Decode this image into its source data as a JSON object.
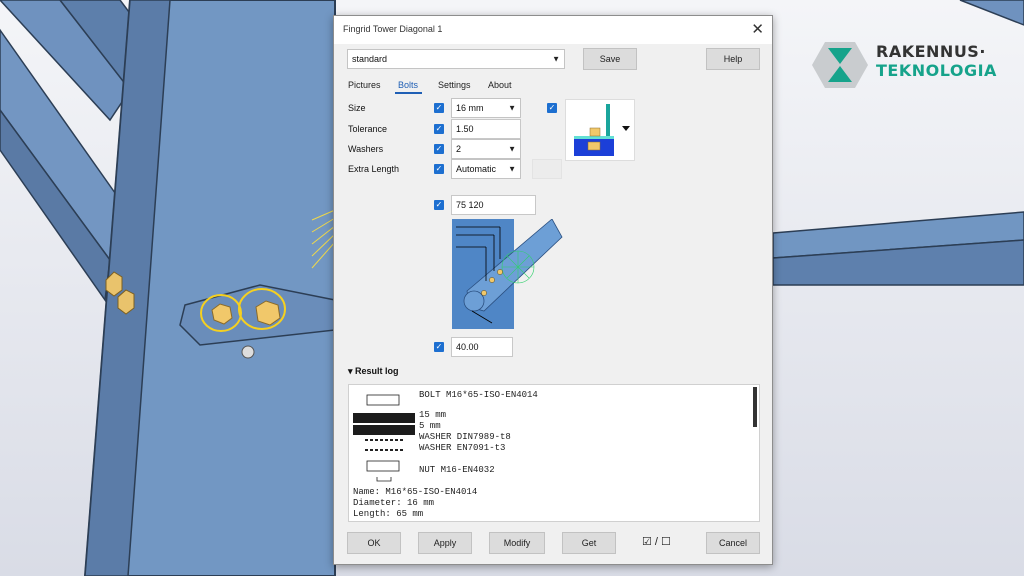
{
  "logo": {
    "line1": "RAKENNUS·",
    "line2": "TEKNOLOGIA"
  },
  "dialog": {
    "title": "Fingrid Tower Diagonal 1",
    "close_icon": "close-icon",
    "preset": {
      "value": "standard"
    },
    "save_label": "Save",
    "help_label": "Help",
    "tabs": [
      {
        "label": "Pictures"
      },
      {
        "label": "Bolts"
      },
      {
        "label": "Settings"
      },
      {
        "label": "About"
      }
    ],
    "active_tab": "Bolts",
    "fields": {
      "size": {
        "label": "Size",
        "value": "16 mm"
      },
      "tolerance": {
        "label": "Tolerance",
        "value": "1.50"
      },
      "washers": {
        "label": "Washers",
        "value": "2"
      },
      "extra_length": {
        "label": "Extra Length",
        "value": "Automatic"
      },
      "bolt_distances": {
        "value": "75 120"
      },
      "edge_distance": {
        "value": "40.00"
      }
    },
    "result_log": {
      "header": "Result log",
      "lines": {
        "bolt": "BOLT M16*65-ISO-EN4014",
        "dim1": "15 mm",
        "dim2": "5 mm",
        "washer1": "WASHER DIN7989-t8",
        "washer2": "WASHER EN7091-t3",
        "nut": "NUT M16-EN4032",
        "name": "Name: M16*65-ISO-EN4014",
        "diameter": "Diameter: 16 mm",
        "length": "Length: 65 mm"
      }
    },
    "footer": {
      "ok": "OK",
      "apply": "Apply",
      "modify": "Modify",
      "get": "Get",
      "toggle": "☑ / ☐",
      "cancel": "Cancel"
    }
  },
  "colors": {
    "accent": "#1d6fd0",
    "steel": "#6c8fbd",
    "bolt_highlight": "#f5d020",
    "brand_green": "#16a38b"
  }
}
